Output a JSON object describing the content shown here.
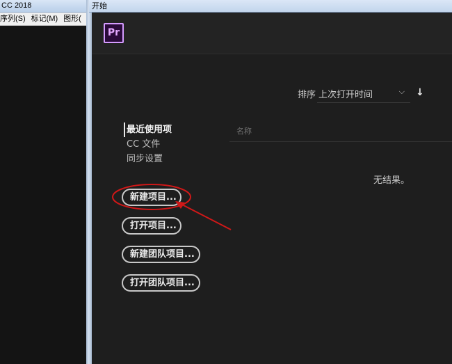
{
  "background_window": {
    "title": "CC 2018",
    "menus": [
      "序列(S)",
      "标记(M)",
      "图形("
    ]
  },
  "dialog": {
    "title": "开始",
    "logo_text": "Pr",
    "sort": {
      "label": "排序",
      "value": "上次打开时间"
    },
    "nav": [
      "最近使用项",
      "CC 文件",
      "同步设置"
    ],
    "column_header": "名称",
    "empty_message": "无结果。",
    "buttons": [
      "新建项目...",
      "打开项目...",
      "新建团队项目...",
      "打开团队项目..."
    ]
  },
  "colors": {
    "annotation_red": "#d01818",
    "logo_purple": "#d59bff",
    "panel_bg": "#1e1e1e"
  }
}
